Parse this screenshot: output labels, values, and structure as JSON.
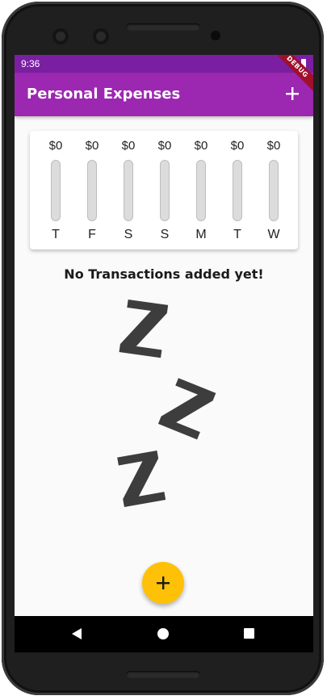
{
  "status_bar": {
    "time": "9:36",
    "battery_icon": "battery-full-icon",
    "debug_label": "DEBUG"
  },
  "app_bar": {
    "title": "Personal Expenses",
    "add_icon": "add-icon"
  },
  "chart": {
    "bars": [
      {
        "amount": "$0",
        "day": "T",
        "fill": 0
      },
      {
        "amount": "$0",
        "day": "F",
        "fill": 0
      },
      {
        "amount": "$0",
        "day": "S",
        "fill": 0
      },
      {
        "amount": "$0",
        "day": "S",
        "fill": 0
      },
      {
        "amount": "$0",
        "day": "M",
        "fill": 0
      },
      {
        "amount": "$0",
        "day": "T",
        "fill": 0
      },
      {
        "amount": "$0",
        "day": "W",
        "fill": 0
      }
    ]
  },
  "empty_state": {
    "message": "No Transactions added yet!",
    "image_icon": "sleeping-zzz-image"
  },
  "fab": {
    "icon": "add-icon"
  },
  "nav_bar": {
    "back_icon": "back-triangle-icon",
    "home_icon": "home-circle-icon",
    "recents_icon": "recents-square-icon"
  },
  "colors": {
    "primary": "#9c27b0",
    "status_bar": "#7b1fa2",
    "accent": "#ffc107"
  }
}
